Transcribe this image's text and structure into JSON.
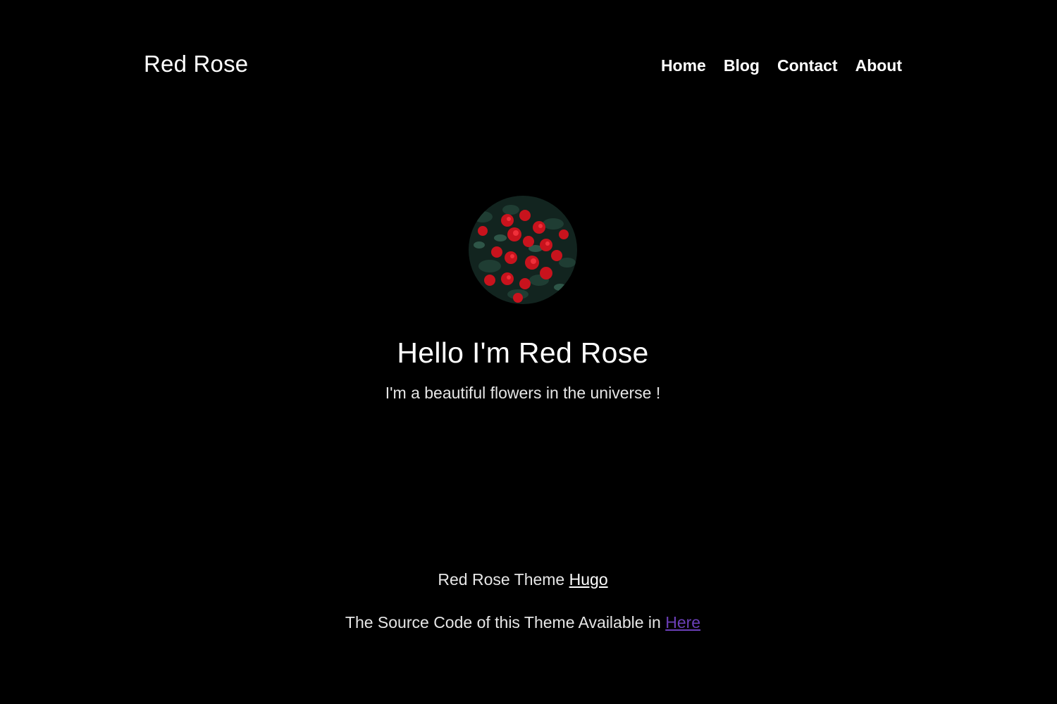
{
  "header": {
    "site_title": "Red Rose",
    "nav": [
      {
        "label": "Home"
      },
      {
        "label": "Blog"
      },
      {
        "label": "Contact"
      },
      {
        "label": "About"
      }
    ]
  },
  "hero": {
    "avatar_icon": "rose-bush-photo",
    "title": "Hello I'm Red Rose",
    "subtitle": "I'm a beautiful flowers in the universe !"
  },
  "footer": {
    "theme_text": "Red Rose Theme ",
    "theme_link": "Hugo",
    "source_text": "The Source Code of this Theme Available in ",
    "source_link": "Here"
  },
  "colors": {
    "background": "#000000",
    "text": "#ffffff",
    "visited_link": "#6b3fb8",
    "rose_red": "#d0151f"
  }
}
